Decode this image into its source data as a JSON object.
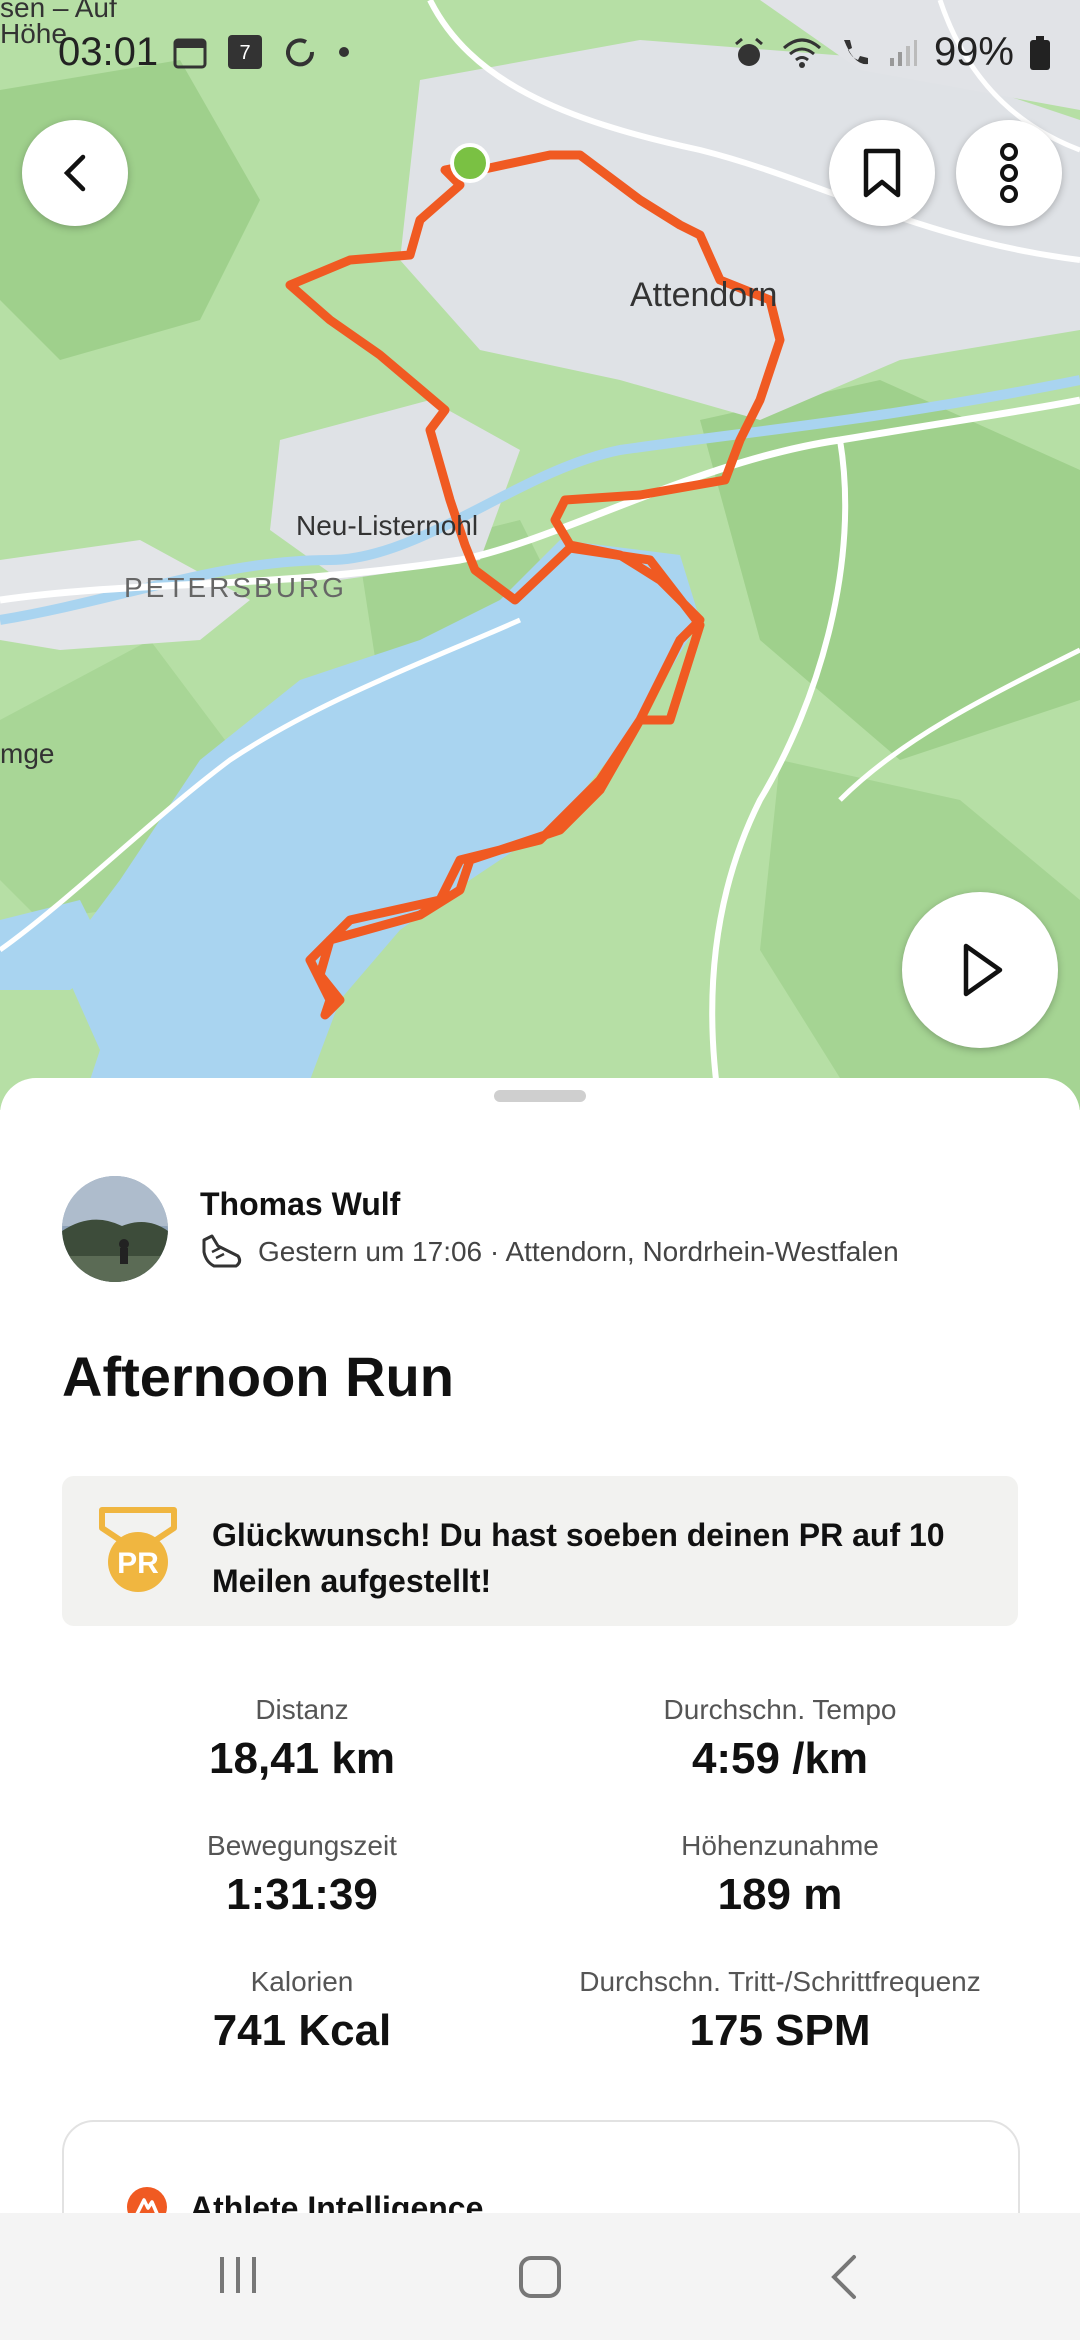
{
  "status_bar": {
    "time": "03:01",
    "calendar_day": "7",
    "battery": "99%"
  },
  "map": {
    "labels": {
      "attendorn": "Attendorn",
      "neu_listernohl": "Neu-Listernohl",
      "petersburg": "PETERSBURG",
      "mge": "mge",
      "top_partial": "sen – Auf",
      "hoehe": "Höhe"
    },
    "route_color": "#f05a22",
    "start_color": "#7ac143",
    "water_color": "#a9d4f0",
    "land_color": "#b6dfa5"
  },
  "activity": {
    "athlete_name": "Thomas Wulf",
    "meta": "Gestern um 17:06 · Attendorn, Nordrhein-Westfalen",
    "title": "Afternoon Run",
    "pr_message": "Glückwunsch! Du hast soeben deinen PR auf 10 Meilen aufgestellt!",
    "pr_badge": "PR",
    "stats": [
      {
        "label": "Distanz",
        "value": "18,41 km"
      },
      {
        "label": "Durchschn. Tempo",
        "value": "4:59 /km"
      },
      {
        "label": "Bewegungszeit",
        "value": "1:31:39"
      },
      {
        "label": "Höhenzunahme",
        "value": "189 m"
      },
      {
        "label": "Kalorien",
        "value": "741 Kcal"
      },
      {
        "label": "Durchschn. Tritt-/Schrittfrequenz",
        "value": "175 SPM"
      }
    ]
  },
  "athlete_intelligence": {
    "title": "Athlete Intelligence"
  },
  "icons": {
    "back": "back-arrow-icon",
    "bookmark": "bookmark-icon",
    "more": "more-vertical-icon",
    "play": "play-icon",
    "shoe": "running-shoe-icon"
  }
}
